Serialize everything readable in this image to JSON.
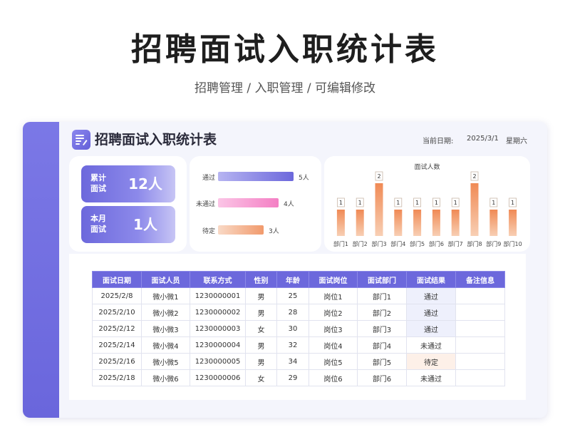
{
  "header": {
    "title": "招聘面试入职统计表",
    "subtitle": "招聘管理 / 入职管理 /  可编辑修改"
  },
  "app": {
    "title": "招聘面试入职统计表",
    "date_label": "当前日期:",
    "date_value": "2025/3/1",
    "weekday": "星期六"
  },
  "kpis": [
    {
      "label": "累计面试",
      "value": "12人"
    },
    {
      "label": "本月面试",
      "value": "1人"
    }
  ],
  "results_chart": {
    "type": "bar",
    "orientation": "horizontal",
    "categories": [
      "通过",
      "未通过",
      "待定"
    ],
    "values": [
      5,
      4,
      3
    ],
    "value_labels": [
      "5人",
      "4人",
      "3人"
    ],
    "colors": [
      "#6c68dc",
      "#f47fc4",
      "#f19a6c"
    ]
  },
  "chart_data": {
    "type": "bar",
    "title": "面试人数",
    "categories": [
      "部门1",
      "部门2",
      "部门3",
      "部门4",
      "部门5",
      "部门6",
      "部门7",
      "部门8",
      "部门9",
      "部门10"
    ],
    "values": [
      1,
      1,
      2,
      1,
      1,
      1,
      1,
      2,
      1,
      1
    ],
    "ylim": [
      0,
      2
    ],
    "grid": false,
    "bar_color": "#f19a6c"
  },
  "table": {
    "columns": [
      "面试日期",
      "面试人员",
      "联系方式",
      "性别",
      "年龄",
      "面试岗位",
      "面试部门",
      "面试结果",
      "备注信息"
    ],
    "rows": [
      [
        "2025/2/8",
        "微小微1",
        "1230000001",
        "男",
        "25",
        "岗位1",
        "部门1",
        "通过",
        ""
      ],
      [
        "2025/2/10",
        "微小微2",
        "1230000002",
        "男",
        "28",
        "岗位2",
        "部门2",
        "通过",
        ""
      ],
      [
        "2025/2/12",
        "微小微3",
        "1230000003",
        "女",
        "30",
        "岗位3",
        "部门3",
        "通过",
        ""
      ],
      [
        "2025/2/14",
        "微小微4",
        "1230000004",
        "男",
        "32",
        "岗位4",
        "部门4",
        "未通过",
        ""
      ],
      [
        "2025/2/16",
        "微小微5",
        "1230000005",
        "男",
        "34",
        "岗位5",
        "部门5",
        "待定",
        ""
      ],
      [
        "2025/2/18",
        "微小微6",
        "1230000006",
        "女",
        "29",
        "岗位6",
        "部门6",
        "未通过",
        ""
      ]
    ]
  },
  "colors": {
    "accent": "#6c68dc",
    "pass": "#5a56d6",
    "pending": "#e2864f"
  },
  "icons": {
    "app": "document-list-icon"
  }
}
